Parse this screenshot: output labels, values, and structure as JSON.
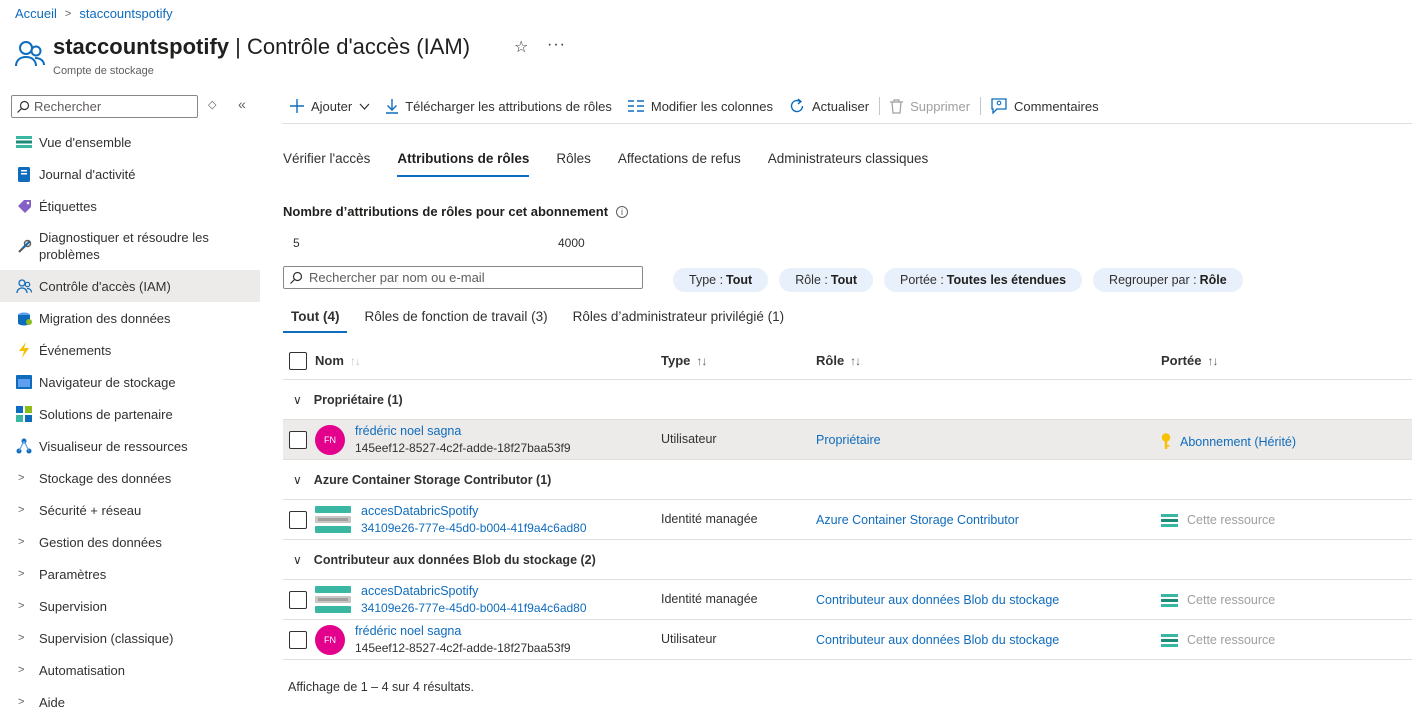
{
  "breadcrumb": {
    "home": "Accueil",
    "resource": "staccountspotify"
  },
  "header": {
    "title_bold": "staccountspotify",
    "title_rest": " | Contrôle d'accès (IAM)",
    "subtitle": "Compte de stockage",
    "star_icon": "☆",
    "more_icon": "···"
  },
  "sidebar": {
    "search_placeholder": "Rechercher",
    "items": [
      {
        "label": "Vue d'ensemble",
        "icon": "storage-overview-icon"
      },
      {
        "label": "Journal d'activité",
        "icon": "activity-log-icon"
      },
      {
        "label": "Étiquettes",
        "icon": "tag-icon"
      },
      {
        "label": "Diagnostiquer et résoudre les problèmes",
        "icon": "wrench-icon"
      },
      {
        "label": "Contrôle d'accès (IAM)",
        "icon": "people-icon",
        "active": true
      },
      {
        "label": "Migration des données",
        "icon": "migration-icon"
      },
      {
        "label": "Événements",
        "icon": "lightning-icon"
      },
      {
        "label": "Navigateur de stockage",
        "icon": "storage-browser-icon"
      },
      {
        "label": "Solutions de partenaire",
        "icon": "partner-icon"
      },
      {
        "label": "Visualiseur de ressources",
        "icon": "resource-visualizer-icon"
      }
    ],
    "groups": [
      "Stockage des données",
      "Sécurité + réseau",
      "Gestion des données",
      "Paramètres",
      "Supervision",
      "Supervision (classique)",
      "Automatisation",
      "Aide"
    ]
  },
  "toolbar": {
    "add": "Ajouter",
    "download": "Télécharger les attributions de rôles",
    "columns": "Modifier les colonnes",
    "refresh": "Actualiser",
    "delete": "Supprimer",
    "feedback": "Commentaires"
  },
  "tabs": [
    "Vérifier l'accès",
    "Attributions de rôles",
    "Rôles",
    "Affectations de refus",
    "Administrateurs classiques"
  ],
  "count": {
    "title": "Nombre d’attributions de rôles pour cet abonnement",
    "current": "5",
    "max": "4000"
  },
  "list_search_placeholder": "Rechercher par nom ou e-mail",
  "filters": [
    {
      "key": "Type :",
      "value": "Tout"
    },
    {
      "key": "Rôle :",
      "value": "Tout"
    },
    {
      "key": "Portée :",
      "value": "Toutes les étendues"
    },
    {
      "key": "Regrouper par :",
      "value": "Rôle"
    }
  ],
  "subtabs": [
    "Tout (4)",
    "Rôles de fonction de travail (3)",
    "Rôles d’administrateur privilégié (1)"
  ],
  "columns": {
    "name": "Nom",
    "type": "Type",
    "role": "Rôle",
    "scope": "Portée",
    "sort_icon": "↑↓"
  },
  "groups": [
    {
      "label": "Propriétaire (1)",
      "rows": [
        {
          "avatar": "FN",
          "name": "frédéric noel sagna",
          "id": "145eef12-8527-4c2f-adde-18f27baa53f9",
          "type": "Utilisateur",
          "role": "Propriétaire",
          "scope": "Abonnement (Hérité)"
        }
      ]
    },
    {
      "label": "Azure Container Storage Contributor (1)",
      "rows": [
        {
          "name": "accesDatabricSpotify",
          "id": "34109e26-777e-45d0-b004-41f9a4c6ad80",
          "type": "Identité managée",
          "role": "Azure Container Storage Contributor",
          "scope": "Cette ressource"
        }
      ]
    },
    {
      "label": "Contributeur aux données Blob du stockage (2)",
      "rows": [
        {
          "name": "accesDatabricSpotify",
          "id": "34109e26-777e-45d0-b004-41f9a4c6ad80",
          "type": "Identité managée",
          "role": "Contributeur aux données Blob du stockage",
          "scope": "Cette ressource"
        },
        {
          "avatar": "FN",
          "name": "frédéric noel sagna",
          "id": "145eef12-8527-4c2f-adde-18f27baa53f9",
          "type": "Utilisateur",
          "role": "Contributeur aux données Blob du stockage",
          "scope": "Cette ressource"
        }
      ]
    }
  ],
  "footer": "Affichage de 1 – 4 sur 4 résultats.",
  "colors": {
    "accent": "#0f6cbd",
    "avatar": "#e3008c",
    "pill": "#e8f0fb",
    "selected_row": "#edebe9"
  }
}
